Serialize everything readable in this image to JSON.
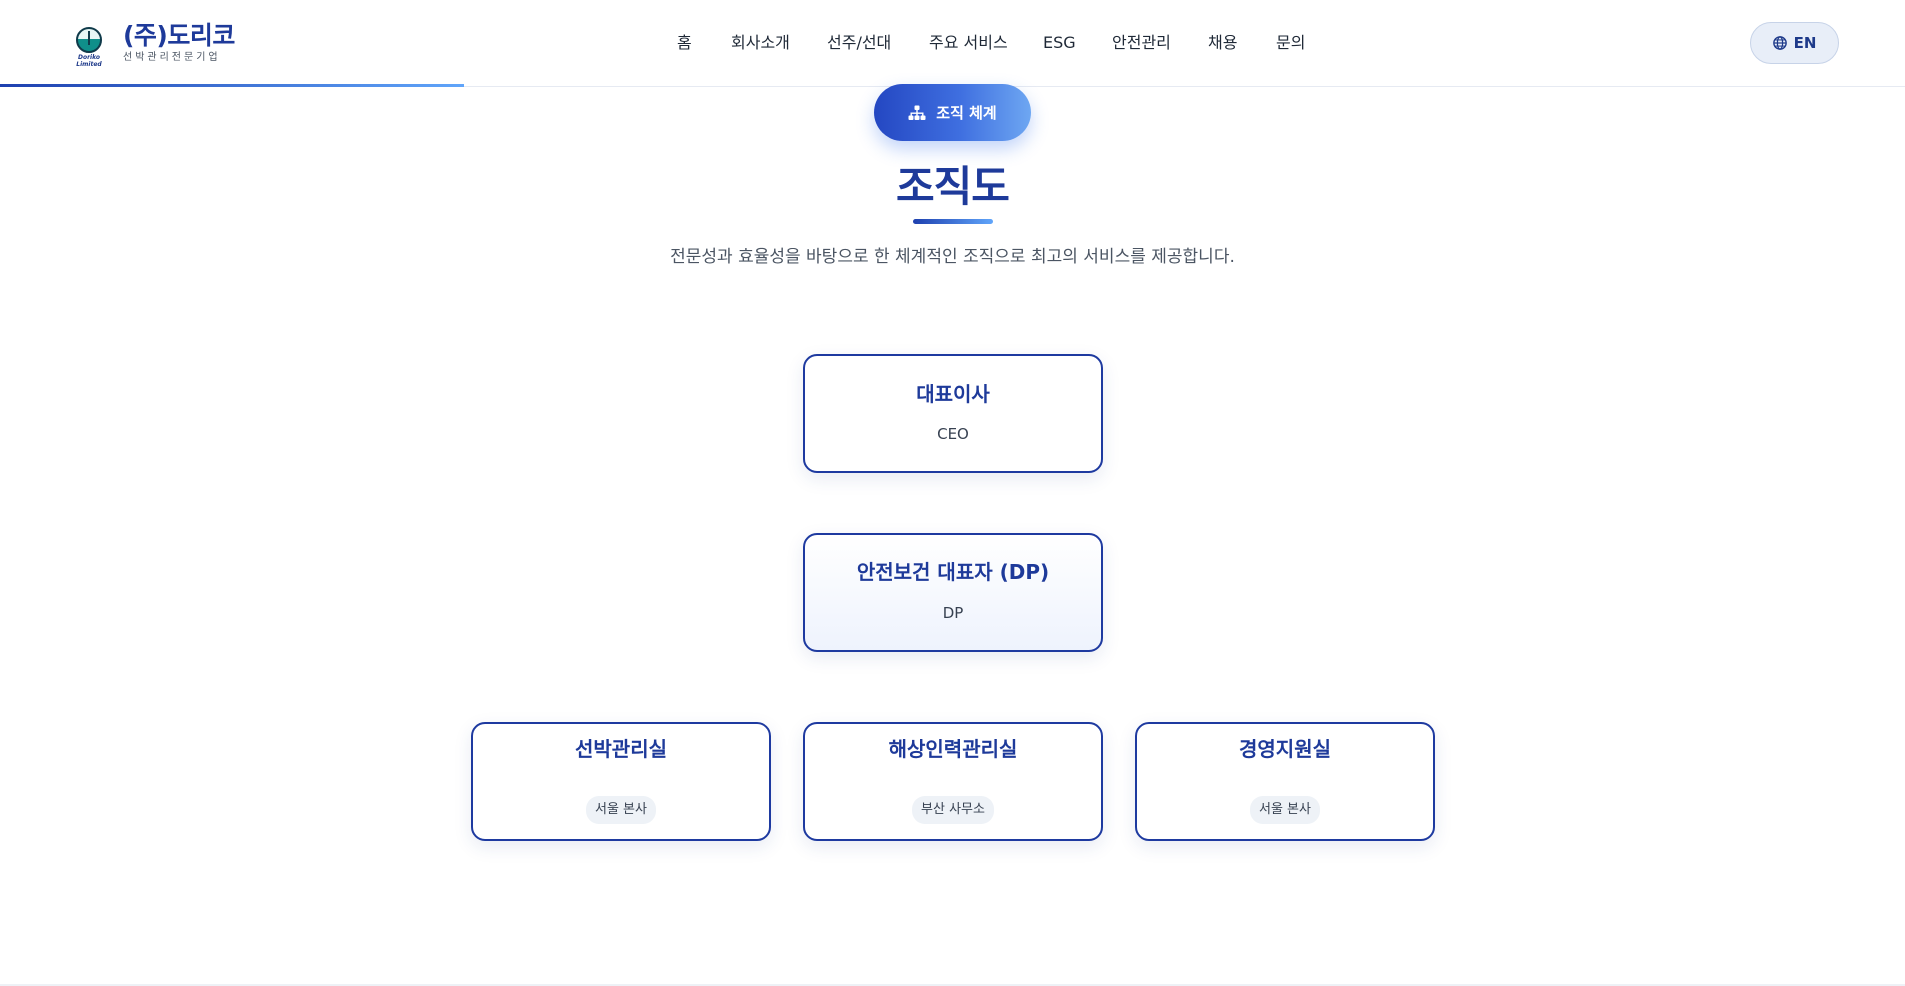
{
  "header": {
    "logo": {
      "title": "(주)도리코",
      "subtitle": "선박관리전문기업",
      "mark_text": "Doriko Limited",
      "icon": "ship-emblem-icon"
    },
    "nav": [
      {
        "label": "홈"
      },
      {
        "label": "회사소개"
      },
      {
        "label": "선주/선대"
      },
      {
        "label": "주요 서비스"
      },
      {
        "label": "ESG"
      },
      {
        "label": "안전관리"
      },
      {
        "label": "채용"
      },
      {
        "label": "문의"
      }
    ],
    "lang_button": {
      "label": "EN",
      "icon": "globe-icon"
    }
  },
  "section": {
    "pill": {
      "label": "조직 체계",
      "icon": "sitemap-icon"
    },
    "title": "조직도",
    "subtitle": "전문성과 효율성을 바탕으로 한 체계적인 조직으로 최고의 서비스를 제공합니다."
  },
  "org": {
    "ceo": {
      "title": "대표이사",
      "subtitle": "CEO"
    },
    "dp": {
      "title": "안전보건 대표자 (DP)",
      "subtitle": "DP"
    },
    "departments": [
      {
        "title": "선박관리실",
        "location": "서울 본사"
      },
      {
        "title": "해상인력관리실",
        "location": "부산 사무소"
      },
      {
        "title": "경영지원실",
        "location": "서울 본사"
      }
    ]
  },
  "colors": {
    "primary": "#1e3a9a",
    "accent_gradient_start": "#2447c2",
    "accent_gradient_end": "#6ea7f2",
    "text": "#1f2937"
  }
}
